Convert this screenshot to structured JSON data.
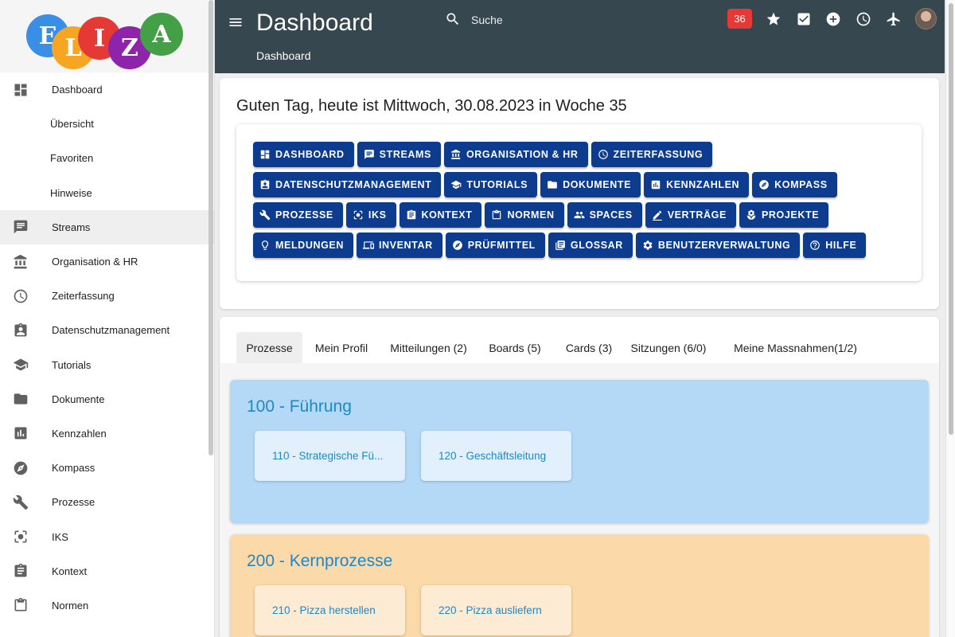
{
  "logo": {
    "letters": [
      {
        "char": "E",
        "color": "#3a8ee6"
      },
      {
        "char": "L",
        "color": "#f6a623"
      },
      {
        "char": "I",
        "color": "#e53935"
      },
      {
        "char": "Z",
        "color": "#8e24aa"
      },
      {
        "char": "A",
        "color": "#43a047"
      }
    ]
  },
  "sidebar": {
    "items": [
      {
        "label": "Dashboard",
        "icon": "dashboard-icon",
        "level": "top"
      },
      {
        "label": "Übersicht",
        "level": "sub"
      },
      {
        "label": "Favoriten",
        "level": "sub"
      },
      {
        "label": "Hinweise",
        "level": "sub"
      },
      {
        "label": "Streams",
        "icon": "chat-icon",
        "level": "top",
        "active": true
      },
      {
        "label": "Organisation & HR",
        "icon": "bank-icon",
        "level": "top"
      },
      {
        "label": "Zeiterfassung",
        "icon": "clock-icon",
        "level": "top"
      },
      {
        "label": "Datenschutzmanagement",
        "icon": "contact-badge-icon",
        "level": "top"
      },
      {
        "label": "Tutorials",
        "icon": "school-icon",
        "level": "top"
      },
      {
        "label": "Dokumente",
        "icon": "folder-icon",
        "level": "top"
      },
      {
        "label": "Kennzahlen",
        "icon": "bar-chart-icon",
        "level": "top"
      },
      {
        "label": "Kompass",
        "icon": "compass-icon",
        "level": "top"
      },
      {
        "label": "Prozesse",
        "icon": "wrench-icon",
        "level": "top"
      },
      {
        "label": "IKS",
        "icon": "focus-icon",
        "level": "top"
      },
      {
        "label": "Kontext",
        "icon": "clipboard-icon",
        "level": "top"
      },
      {
        "label": "Normen",
        "icon": "clipboard-outline-icon",
        "level": "top"
      }
    ]
  },
  "topbar": {
    "title": "Dashboard",
    "breadcrumb": "Dashboard",
    "search_placeholder": "Suche",
    "notification_count": "36",
    "background": "#37474f"
  },
  "greeting": {
    "text": "Guten Tag, heute ist Mittwoch, 30.08.2023 in Woche 35"
  },
  "quick_buttons": {
    "color": "#0d3b8e",
    "rows": [
      [
        {
          "label": "DASHBOARD",
          "icon": "dashboard-icon"
        },
        {
          "label": "STREAMS",
          "icon": "chat-icon"
        },
        {
          "label": "ORGANISATION & HR",
          "icon": "bank-icon"
        },
        {
          "label": "ZEITERFASSUNG",
          "icon": "clock-icon"
        }
      ],
      [
        {
          "label": "DATENSCHUTZMANAGEMENT",
          "icon": "contact-badge-icon"
        },
        {
          "label": "TUTORIALS",
          "icon": "school-icon"
        },
        {
          "label": "DOKUMENTE",
          "icon": "folder-icon"
        },
        {
          "label": "KENNZAHLEN",
          "icon": "bar-chart-icon"
        },
        {
          "label": "KOMPASS",
          "icon": "compass-icon"
        }
      ],
      [
        {
          "label": "PROZESSE",
          "icon": "wrench-icon"
        },
        {
          "label": "IKS",
          "icon": "focus-icon"
        },
        {
          "label": "KONTEXT",
          "icon": "clipboard-icon"
        },
        {
          "label": "NORMEN",
          "icon": "clipboard-outline-icon"
        },
        {
          "label": "SPACES",
          "icon": "people-icon"
        },
        {
          "label": "VERTRÄGE",
          "icon": "pen-icon"
        },
        {
          "label": "PROJEKTE",
          "icon": "sprout-icon"
        }
      ],
      [
        {
          "label": "MELDUNGEN",
          "icon": "lightbulb-icon"
        },
        {
          "label": "INVENTAR",
          "icon": "devices-icon"
        },
        {
          "label": "PRÜFMITTEL",
          "icon": "compass-icon"
        },
        {
          "label": "GLOSSAR",
          "icon": "library-icon"
        },
        {
          "label": "BENUTZERVERWALTUNG",
          "icon": "gear-icon"
        },
        {
          "label": "HILFE",
          "icon": "help-icon"
        }
      ]
    ]
  },
  "tabs": [
    {
      "label": "Prozesse",
      "active": true
    },
    {
      "label": "Mein Profil"
    },
    {
      "label": "Mitteilungen (2)"
    },
    {
      "label": "Boards (5)"
    },
    {
      "label": "Cards (3)"
    },
    {
      "label": "Sitzungen (6/0)"
    },
    {
      "label": "Meine Massnahmen(1/2)"
    }
  ],
  "process_groups": [
    {
      "title": "100 - Führung",
      "background": "#b3d9f7",
      "card_background": "#e1f0fc",
      "items": [
        "110 - Strategische Fü...",
        "120 - Geschäftsleitung"
      ]
    },
    {
      "title": "200 - Kernprozesse",
      "background": "#fcd9a8",
      "card_background": "#fdebd3",
      "items": [
        "210 - Pizza herstellen",
        "220 - Pizza ausliefern"
      ]
    }
  ]
}
